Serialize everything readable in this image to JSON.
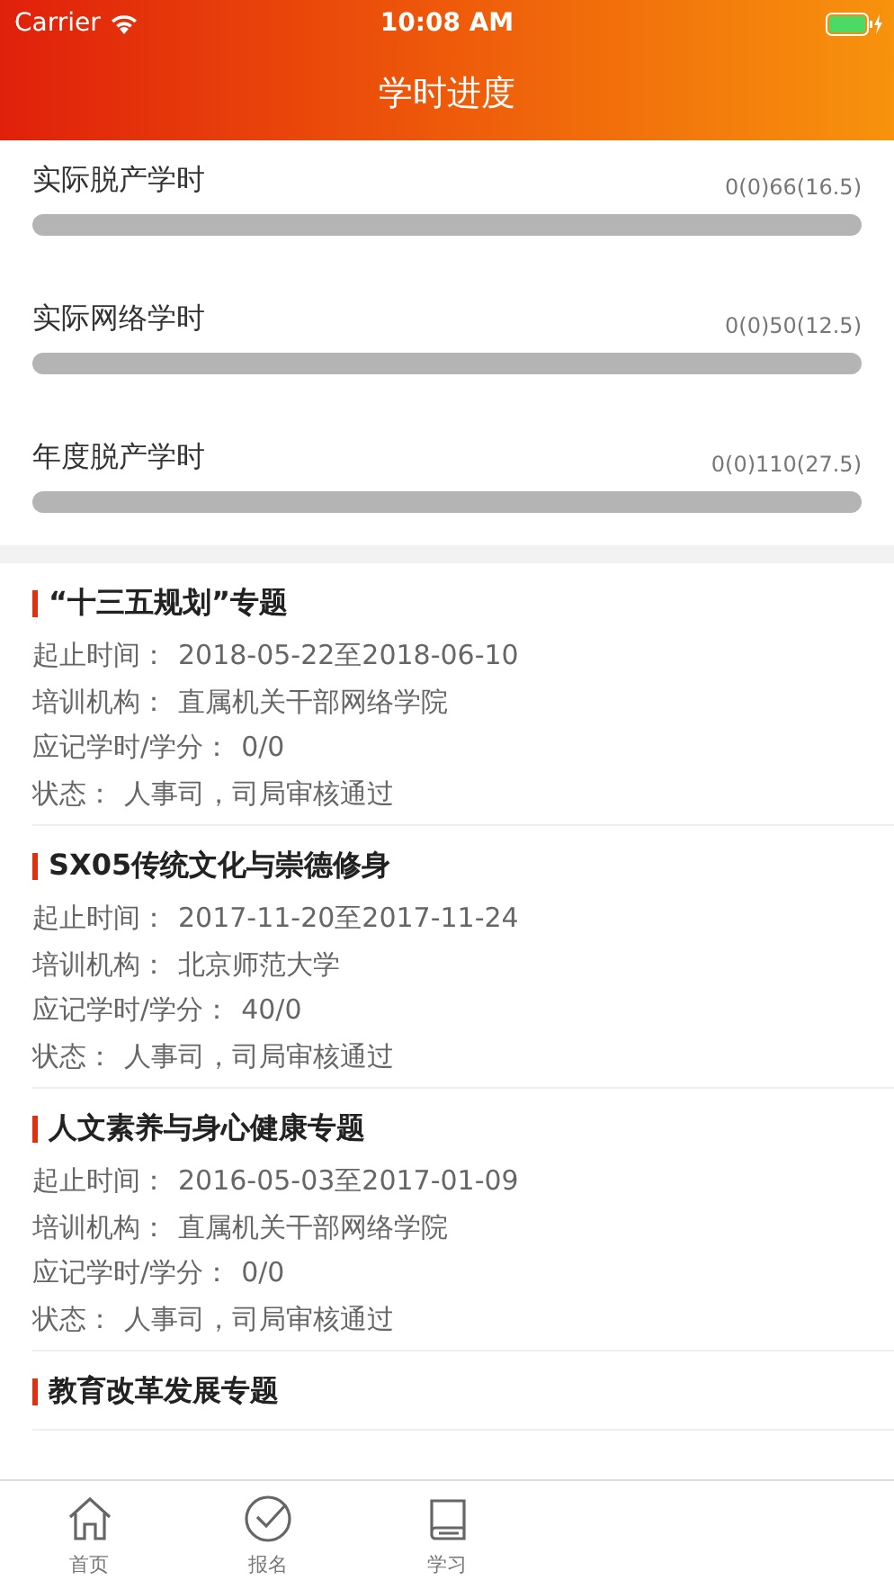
{
  "status_bar": {
    "carrier": "Carrier",
    "time": "10:08 AM"
  },
  "title": "学时进度",
  "progress": [
    {
      "label": "实际脱产学时",
      "reading": "0(0)66(16.5)",
      "level": 0
    },
    {
      "label": "实际网络学时",
      "reading": "0(0)50(12.5)",
      "level": 0
    },
    {
      "label": "年度脱产学时",
      "reading": "0(0)110(27.5)",
      "level": 0
    }
  ],
  "courses": [
    {
      "title": "“十三五规划”专题",
      "fields": [
        {
          "label": "起止时间：",
          "value": "2018-05-22至2018-06-10"
        },
        {
          "label": "培训机构：",
          "value": "直属机关干部网络学院"
        },
        {
          "label": "应记学时/学分：",
          "value": "0/0"
        },
        {
          "label": "状态：",
          "value": "人事司，司局审核通过"
        }
      ]
    },
    {
      "title": "SX05传统文化与崇德修身",
      "fields": [
        {
          "label": "起止时间：",
          "value": "2017-11-20至2017-11-24"
        },
        {
          "label": "培训机构：",
          "value": "北京师范大学"
        },
        {
          "label": "应记学时/学分：",
          "value": "40/0"
        },
        {
          "label": "状态：",
          "value": "人事司，司局审核通过"
        }
      ]
    },
    {
      "title": "人文素养与身心健康专题",
      "fields": [
        {
          "label": "起止时间：",
          "value": "2016-05-03至2017-01-09"
        },
        {
          "label": "培训机构：",
          "value": "直属机关干部网络学院"
        },
        {
          "label": "应记学时/学分：",
          "value": "0/0"
        },
        {
          "label": "状态：",
          "value": "人事司，司局审核通过"
        }
      ]
    },
    {
      "title": "教育改革发展专题"
    }
  ],
  "tab_bar": [
    {
      "label": "首页",
      "kind": "home",
      "selected": false
    },
    {
      "label": "报名",
      "kind": "check",
      "selected": false
    },
    {
      "label": "学习",
      "kind": "book",
      "selected": false
    }
  ]
}
